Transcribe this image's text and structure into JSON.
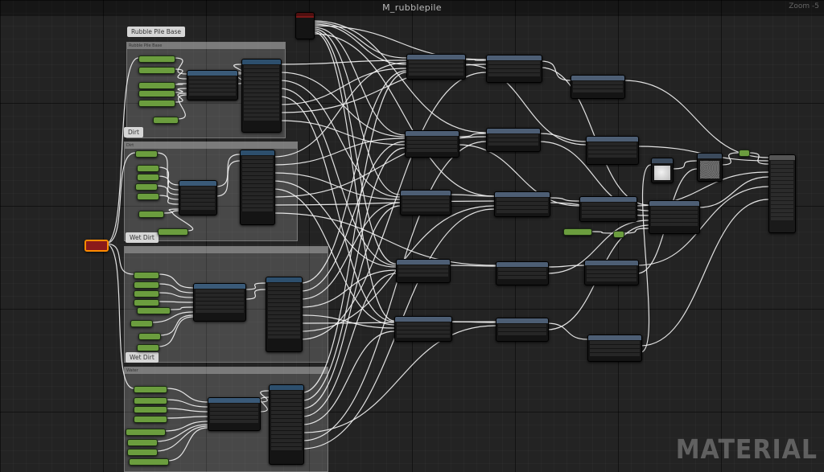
{
  "graph": {
    "title": "M_rubblepile",
    "zoom": "Zoom -5"
  },
  "watermark": "MATERIAL",
  "comments": [
    {
      "id": "rubble",
      "bubble": "Rubble Pile Base",
      "bar": "Rubble Pile Base"
    },
    {
      "id": "dirt",
      "bubble": "Dirt",
      "bar": "Dirt"
    },
    {
      "id": "wetdirt",
      "bubble": "Wet Dirt",
      "bar": "Wet Dirt"
    },
    {
      "id": "water",
      "bubble": "Wet Dirt",
      "bar": "Water"
    }
  ]
}
